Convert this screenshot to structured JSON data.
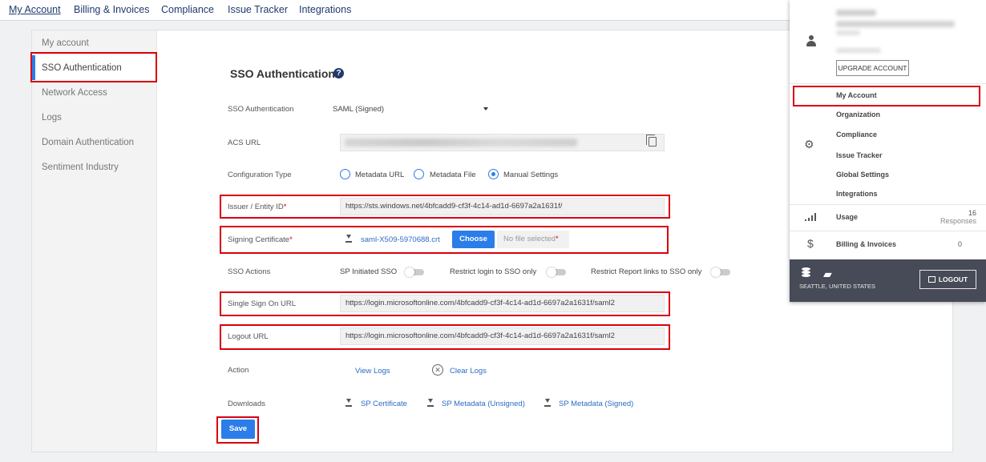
{
  "topnav": {
    "tabs": [
      "My Account",
      "Billing & Invoices",
      "Compliance",
      "Issue Tracker",
      "Integrations"
    ]
  },
  "sidebar": {
    "items": [
      "My account",
      "SSO Authentication",
      "Network Access",
      "Logs",
      "Domain Authentication",
      "Sentiment Industry"
    ]
  },
  "form": {
    "title": "SSO Authentication",
    "sso_auth_label": "SSO Authentication",
    "sso_auth_value": "SAML (Signed)",
    "acs_url_label": "ACS URL",
    "config_type_label": "Configuration Type",
    "config_options": [
      "Metadata URL",
      "Metadata File",
      "Manual Settings"
    ],
    "issuer_label": "Issuer / Entity ID",
    "issuer_value": "https://sts.windows.net/4bfcadd9-cf3f-4c14-ad1d-6697a2a1631f/",
    "signing_cert_label": "Signing Certificate",
    "signing_cert_file": "saml-X509-5970688.crt",
    "choose_label": "Choose",
    "no_file_label": "No file selected",
    "sso_actions_label": "SSO Actions",
    "sso_actions": [
      "SP Initiated SSO",
      "Restrict login to SSO only",
      "Restrict Report links to SSO only"
    ],
    "sso_url_label": "Single Sign On URL",
    "sso_url_value": "https://login.microsoftonline.com/4bfcadd9-cf3f-4c14-ad1d-6697a2a1631f/saml2",
    "logout_url_label": "Logout URL",
    "logout_url_value": "https://login.microsoftonline.com/4bfcadd9-cf3f-4c14-ad1d-6697a2a1631f/saml2",
    "action_label": "Action",
    "view_logs": "View Logs",
    "clear_logs": "Clear Logs",
    "downloads_label": "Downloads",
    "downloads": [
      "SP Certificate",
      "SP Metadata (Unsigned)",
      "SP Metadata (Signed)"
    ],
    "save_label": "Save",
    "required_mark": "*"
  },
  "panel": {
    "upgrade_label": "UPGRADE ACCOUNT",
    "menu": [
      "My Account",
      "Organization",
      "Compliance",
      "Issue Tracker",
      "Global Settings",
      "Integrations"
    ],
    "usage_label": "Usage",
    "usage_count": "16",
    "usage_unit": "Responses",
    "billing_label": "Billing & Invoices",
    "billing_count": "0",
    "location": "SEATTLE, UNITED STATES",
    "logout_label": "LOGOUT"
  },
  "colors": {
    "accent": "#2b7de9",
    "highlight": "#d9000d",
    "nav": "#1f3a6e",
    "footer": "#474a57"
  }
}
